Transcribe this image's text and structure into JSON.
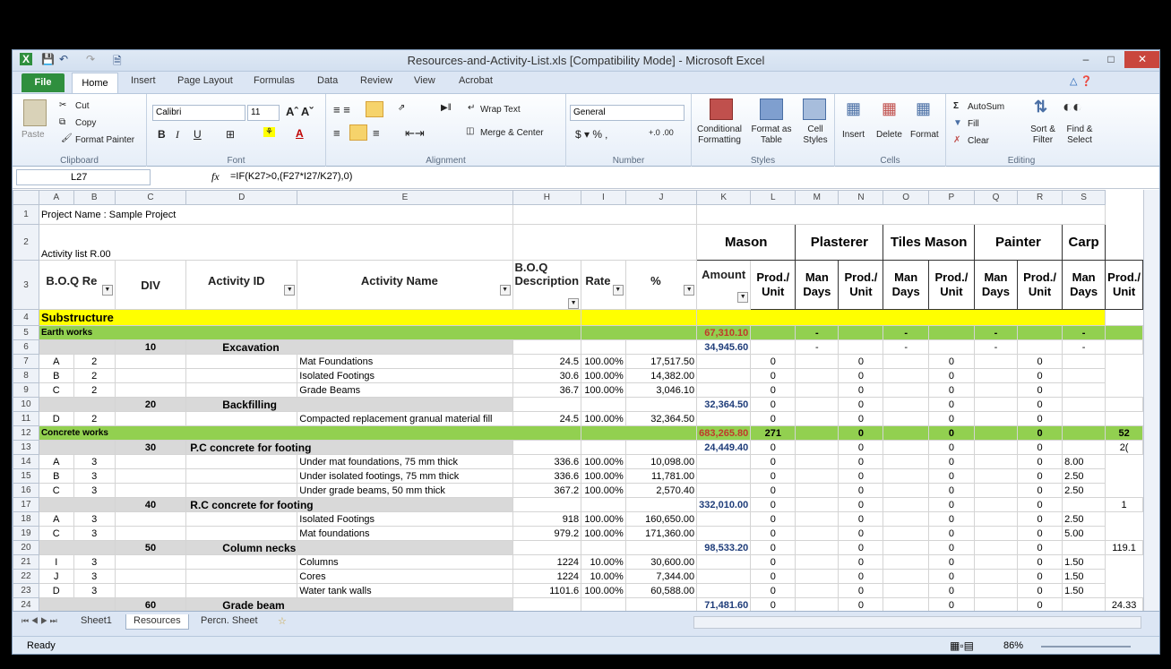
{
  "app": {
    "title": "Resources-and-Activity-List.xls  [Compatibility Mode]  -  Microsoft Excel"
  },
  "tabs": [
    "File",
    "Home",
    "Insert",
    "Page Layout",
    "Formulas",
    "Data",
    "Review",
    "View",
    "Acrobat"
  ],
  "ribbon": {
    "clipboard": {
      "paste": "Paste",
      "cut": "Cut",
      "copy": "Copy",
      "format_painter": "Format Painter",
      "label": "Clipboard"
    },
    "font": {
      "name": "Calibri",
      "size": "11",
      "label": "Font"
    },
    "alignment": {
      "wrap": "Wrap Text",
      "merge": "Merge & Center",
      "label": "Alignment"
    },
    "number": {
      "format": "General",
      "label": "Number"
    },
    "styles": {
      "conditional": "Conditional Formatting",
      "format_table": "Format as Table",
      "cell_styles": "Cell Styles",
      "label": "Styles"
    },
    "cells": {
      "insert": "Insert",
      "delete": "Delete",
      "format": "Format",
      "label": "Cells"
    },
    "editing": {
      "autosum": "AutoSum",
      "fill": "Fill",
      "clear": "Clear",
      "sort": "Sort & Filter",
      "find": "Find & Select",
      "label": "Editing"
    }
  },
  "formula_bar": {
    "cell": "L27",
    "fx": "fx",
    "formula": "=IF(K27>0,(F27*I27/K27),0)"
  },
  "columns": [
    "A",
    "B",
    "C",
    "D",
    "E",
    "H",
    "I",
    "J",
    "K",
    "L",
    "M",
    "N",
    "O",
    "P",
    "Q",
    "R",
    "S"
  ],
  "header": {
    "project": "Project Name : Sample Project",
    "activity_list": "Activity list R.00",
    "boq": "B.O.Q Re",
    "div": "DIV",
    "activity_id": "Activity ID",
    "activity_name": "Activity Name",
    "boq_desc": "B.O.Q Description",
    "rate": "Rate",
    "pct": "%",
    "amount": "Amount",
    "trades": [
      "Mason",
      "Plasterer",
      "Tiles Mason",
      "Painter",
      "Carp"
    ],
    "prod": "Prod./ Unit",
    "man": "Man Days"
  },
  "rows": [
    {
      "n": "4",
      "type": "section",
      "label": "Substructure"
    },
    {
      "n": "5",
      "type": "group",
      "label": "Earth works",
      "amt": "67,310.10",
      "vals": [
        "",
        "-",
        "",
        "-",
        "",
        "-",
        "",
        "-",
        ""
      ]
    },
    {
      "n": "6",
      "type": "act",
      "id": "10",
      "name": "Excavation",
      "amt": "34,945.60",
      "vals": [
        "",
        "-",
        "",
        "-",
        "",
        "-",
        "",
        "-",
        ""
      ]
    },
    {
      "n": "7",
      "type": "item",
      "a": "A",
      "b": "2",
      "desc": "Mat Foundations",
      "rate": "24.5",
      "pct": "100.00%",
      "amt": "17,517.50",
      "vals": [
        "",
        "0",
        "",
        "0",
        "",
        "0",
        "",
        "0",
        ""
      ]
    },
    {
      "n": "8",
      "type": "item",
      "a": "B",
      "b": "2",
      "desc": "Isolated Footings",
      "rate": "30.6",
      "pct": "100.00%",
      "amt": "14,382.00",
      "vals": [
        "",
        "0",
        "",
        "0",
        "",
        "0",
        "",
        "0",
        ""
      ]
    },
    {
      "n": "9",
      "type": "item",
      "a": "C",
      "b": "2",
      "desc": "Grade Beams",
      "rate": "36.7",
      "pct": "100.00%",
      "amt": "3,046.10",
      "vals": [
        "",
        "0",
        "",
        "0",
        "",
        "0",
        "",
        "0",
        ""
      ]
    },
    {
      "n": "10",
      "type": "act",
      "id": "20",
      "name": "Backfilling",
      "amt": "32,364.50",
      "vals": [
        "0",
        "",
        "0",
        "",
        "0",
        "",
        "0",
        "",
        ""
      ]
    },
    {
      "n": "11",
      "type": "item",
      "a": "D",
      "b": "2",
      "desc": "Compacted replacement granual material fill",
      "rate": "24.5",
      "pct": "100.00%",
      "amt": "32,364.50",
      "vals": [
        "",
        "0",
        "",
        "0",
        "",
        "0",
        "",
        "0",
        ""
      ]
    },
    {
      "n": "12",
      "type": "group",
      "label": "Concrete works",
      "amt": "683,265.80",
      "vals": [
        "271",
        "",
        "0",
        "",
        "0",
        "",
        "0",
        "",
        "52"
      ]
    },
    {
      "n": "13",
      "type": "act",
      "id": "30",
      "name": "P.C concrete for footing",
      "amt": "24,449.40",
      "vals": [
        "0",
        "",
        "0",
        "",
        "0",
        "",
        "0",
        "",
        "2("
      ]
    },
    {
      "n": "14",
      "type": "item",
      "a": "A",
      "b": "3",
      "desc": "Under mat foundations, 75 mm thick",
      "rate": "336.6",
      "pct": "100.00%",
      "amt": "10,098.00",
      "vals": [
        "",
        "0",
        "",
        "0",
        "",
        "0",
        "",
        "0",
        "8.00"
      ]
    },
    {
      "n": "15",
      "type": "item",
      "a": "B",
      "b": "3",
      "desc": "Under isolated footings, 75 mm thick",
      "rate": "336.6",
      "pct": "100.00%",
      "amt": "11,781.00",
      "vals": [
        "",
        "0",
        "",
        "0",
        "",
        "0",
        "",
        "0",
        "2.50"
      ]
    },
    {
      "n": "16",
      "type": "item",
      "a": "C",
      "b": "3",
      "desc": "Under grade beams, 50 mm thick",
      "rate": "367.2",
      "pct": "100.00%",
      "amt": "2,570.40",
      "vals": [
        "",
        "0",
        "",
        "0",
        "",
        "0",
        "",
        "0",
        "2.50"
      ]
    },
    {
      "n": "17",
      "type": "act",
      "id": "40",
      "name": "R.C concrete for footing",
      "amt": "332,010.00",
      "vals": [
        "0",
        "",
        "0",
        "",
        "0",
        "",
        "0",
        "",
        "1"
      ]
    },
    {
      "n": "18",
      "type": "item",
      "a": "A",
      "b": "3",
      "desc": "Isolated Footings",
      "rate": "918",
      "pct": "100.00%",
      "amt": "160,650.00",
      "vals": [
        "",
        "0",
        "",
        "0",
        "",
        "0",
        "",
        "0",
        "2.50"
      ]
    },
    {
      "n": "19",
      "type": "item",
      "a": "C",
      "b": "3",
      "desc": "Mat foundations",
      "rate": "979.2",
      "pct": "100.00%",
      "amt": "171,360.00",
      "vals": [
        "",
        "0",
        "",
        "0",
        "",
        "0",
        "",
        "0",
        "5.00"
      ]
    },
    {
      "n": "20",
      "type": "act",
      "id": "50",
      "name": "Column necks",
      "amt": "98,533.20",
      "vals": [
        "0",
        "",
        "0",
        "",
        "0",
        "",
        "0",
        "",
        "119.1"
      ]
    },
    {
      "n": "21",
      "type": "item",
      "a": "I",
      "b": "3",
      "desc": "Columns",
      "rate": "1224",
      "pct": "10.00%",
      "amt": "30,600.00",
      "vals": [
        "",
        "0",
        "",
        "0",
        "",
        "0",
        "",
        "0",
        "1.50"
      ]
    },
    {
      "n": "22",
      "type": "item",
      "a": "J",
      "b": "3",
      "desc": "Cores",
      "rate": "1224",
      "pct": "10.00%",
      "amt": "7,344.00",
      "vals": [
        "",
        "0",
        "",
        "0",
        "",
        "0",
        "",
        "0",
        "1.50"
      ]
    },
    {
      "n": "23",
      "type": "item",
      "a": "D",
      "b": "3",
      "desc": "Water tank walls",
      "rate": "1101.6",
      "pct": "100.00%",
      "amt": "60,588.00",
      "vals": [
        "",
        "0",
        "",
        "0",
        "",
        "0",
        "",
        "0",
        "1.50"
      ]
    },
    {
      "n": "24",
      "type": "act",
      "id": "60",
      "name": "Grade beam",
      "amt": "71,481.60",
      "vals": [
        "0",
        "",
        "0",
        "",
        "0",
        "",
        "0",
        "",
        "24.33"
      ]
    }
  ],
  "sheets": [
    "Sheet1",
    "Resources",
    "Percn. Sheet"
  ],
  "status": {
    "ready": "Ready",
    "zoom": "86%"
  }
}
